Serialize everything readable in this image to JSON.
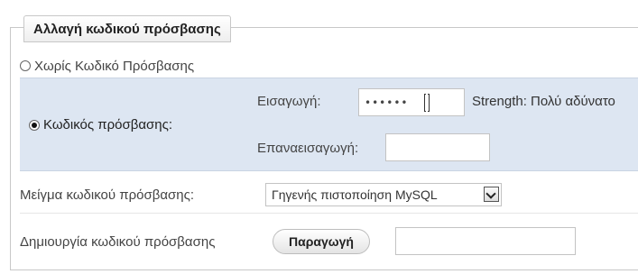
{
  "legend": "Αλλαγή κωδικού πρόσβασης",
  "no_password": {
    "label": "Χωρίς Κωδικό Πρόσβασης",
    "selected": false
  },
  "password": {
    "label": "Κωδικός πρόσβασης:",
    "selected": true,
    "enter_label": "Εισαγωγή:",
    "enter_value": "••••••",
    "strength_text": "Strength: Πολύ αδύνατο",
    "reenter_label": "Επαναεισαγωγή:",
    "reenter_value": ""
  },
  "hashing": {
    "label": "Μείγμα κωδικού πρόσβασης:",
    "selected_option": "Γηγενής πιστοποίηση MySQL"
  },
  "generate": {
    "label": "Δημιουργία κωδικού πρόσβασης",
    "button_label": "Παραγωγή",
    "output_value": ""
  }
}
